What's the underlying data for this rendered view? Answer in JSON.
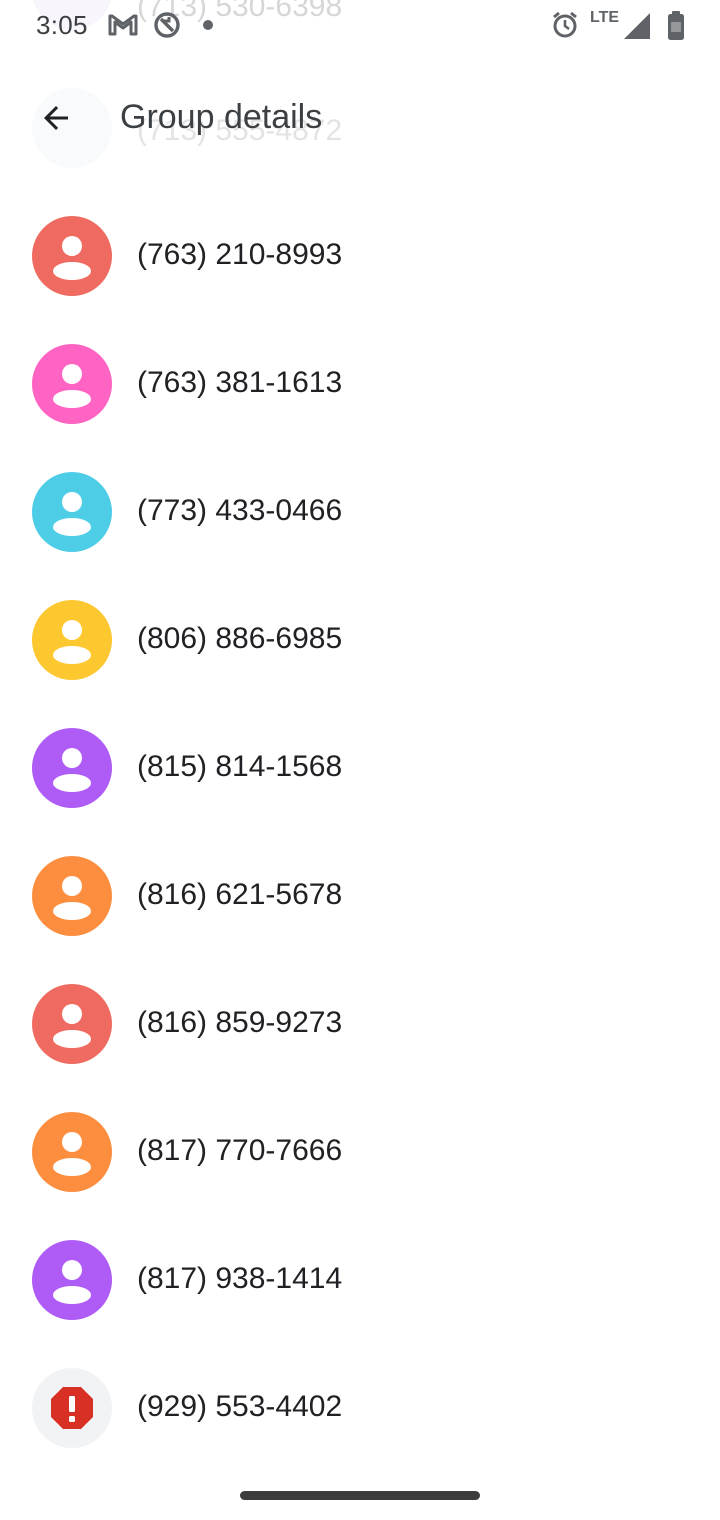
{
  "status_bar": {
    "time": "3:05",
    "network": "LTE",
    "icons": [
      "gmail-icon",
      "sync-off-icon",
      "notification-dot-icon",
      "alarm-icon",
      "signal-icon",
      "battery-icon"
    ]
  },
  "ghost_rows": [
    {
      "number": "(713) 530-6398",
      "color": "#d9c6f0"
    },
    {
      "number": "(713) 555-4872",
      "color": "#bde0e6"
    }
  ],
  "app_bar": {
    "back_icon": "arrow-back-icon",
    "title": "Group details"
  },
  "contacts": [
    {
      "number": "(763) 210-8993",
      "color": "#ef6b61",
      "icon": "person-icon"
    },
    {
      "number": "(763) 381-1613",
      "color": "#ff63c4",
      "icon": "person-icon"
    },
    {
      "number": "(773) 433-0466",
      "color": "#4ecde6",
      "icon": "person-icon"
    },
    {
      "number": "(806) 886-6985",
      "color": "#fdc72f",
      "icon": "person-icon"
    },
    {
      "number": "(815) 814-1568",
      "color": "#af5cf7",
      "icon": "person-icon"
    },
    {
      "number": "(816) 621-5678",
      "color": "#fd8e3f",
      "icon": "person-icon"
    },
    {
      "number": "(816) 859-9273",
      "color": "#ef6b61",
      "icon": "person-icon"
    },
    {
      "number": "(817) 770-7666",
      "color": "#fd8e3f",
      "icon": "person-icon"
    },
    {
      "number": "(817) 938-1414",
      "color": "#af5cf7",
      "icon": "person-icon"
    },
    {
      "number": "(929) 553-4402",
      "color": "#f1f3f4",
      "icon": "error-icon",
      "icon_color": "#d93025"
    }
  ]
}
